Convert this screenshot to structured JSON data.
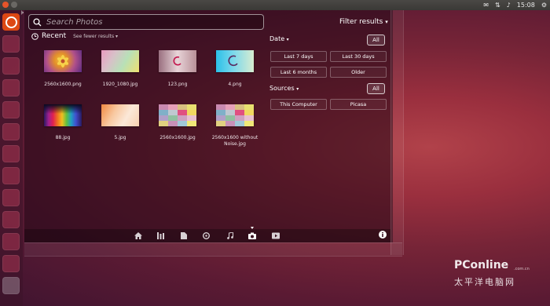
{
  "panel": {
    "time": "15:08"
  },
  "search": {
    "value": "",
    "placeholder": "Search Photos"
  },
  "recent": {
    "label": "Recent",
    "see_fewer": "See fewer results"
  },
  "photos": [
    {
      "caption": "2560x1600.png",
      "colors": [
        "#e39a2d",
        "#6a2f86"
      ]
    },
    {
      "caption": "1920_1080.jpg",
      "colors": [
        "#e88fb0",
        "#e8e26a"
      ]
    },
    {
      "caption": "123.png",
      "colors": [
        "#c9a0a8",
        "#f0d8d8"
      ]
    },
    {
      "caption": "4.png",
      "colors": [
        "#34c7e8",
        "#c4e8e0"
      ]
    },
    {
      "caption": "88.jpg",
      "colors": [
        "#1a1a3a",
        "#e8b030"
      ]
    },
    {
      "caption": "5.jpg",
      "colors": [
        "#f4a860",
        "#f8ecd8"
      ]
    },
    {
      "caption": "2560x1600.jpg",
      "colors": [
        "#c08ab0",
        "#e8e070"
      ]
    },
    {
      "caption": "2560x1600 without Noise.jpg",
      "colors": [
        "#c08ab0",
        "#e8e070"
      ]
    }
  ],
  "filter": {
    "title": "Filter results",
    "date_label": "Date",
    "date_all": "All",
    "date_options": [
      "Last 7 days",
      "Last 30 days",
      "Last 6 months",
      "Older"
    ],
    "sources_label": "Sources",
    "sources_all": "All",
    "source_options": [
      "This Computer",
      "Picasa"
    ]
  },
  "lenses": [
    {
      "icon": "home-icon"
    },
    {
      "icon": "applications-icon"
    },
    {
      "icon": "files-icon"
    },
    {
      "icon": "music-note-icon"
    },
    {
      "icon": "music-icon"
    },
    {
      "icon": "camera-icon"
    },
    {
      "icon": "video-icon"
    }
  ],
  "watermark": {
    "brand": "PConline",
    "sub": ".com.cn",
    "cn": "太平洋电脑网"
  },
  "colors": {
    "ubuntu_orange": "#dd4814"
  }
}
